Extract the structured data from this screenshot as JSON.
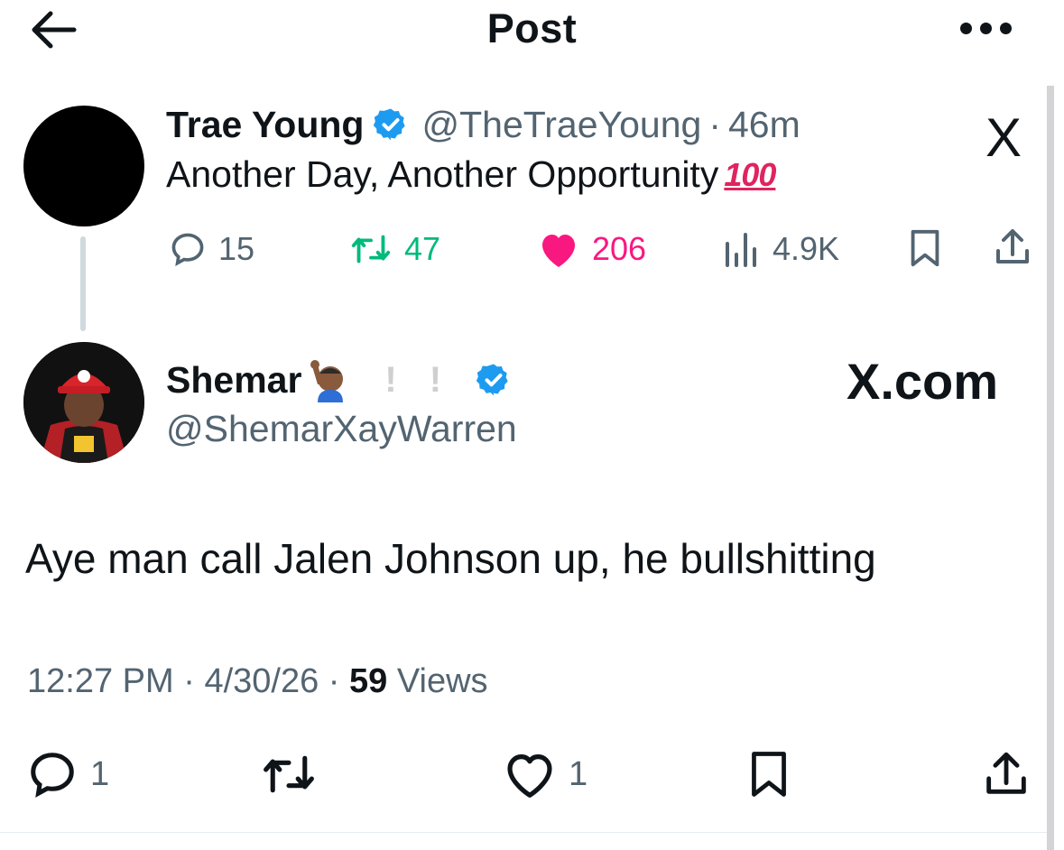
{
  "header": {
    "title": "Post",
    "back_icon": "arrow-left-icon",
    "more_icon": "ellipsis-icon"
  },
  "parent_tweet": {
    "author_name": "Trae Young",
    "handle": "@TheTraeYoung",
    "separator": "·",
    "time": "46m",
    "text": "Another Day, Another Opportunity",
    "emoji": "100",
    "logo_text": "X",
    "stats": {
      "replies": "15",
      "retweets": "47",
      "likes": "206",
      "views": "4.9K"
    }
  },
  "reply_tweet": {
    "author_name": "Shemar",
    "excl_1": "!",
    "excl_2": "!",
    "handle": "@ShemarXayWarren",
    "watermark": "X.com",
    "text": "Aye man call Jalen Johnson up, he bullshitting",
    "time": "12:27 PM",
    "separator": "·",
    "date": "4/30/26",
    "views_count": "59",
    "views_label": "Views",
    "actions": {
      "replies": "1",
      "likes": "1"
    }
  },
  "colors": {
    "text": "#0f1419",
    "muted": "#536471",
    "verified": "#1d9bf0",
    "retweet": "#00ba7c",
    "like": "#f91880"
  }
}
